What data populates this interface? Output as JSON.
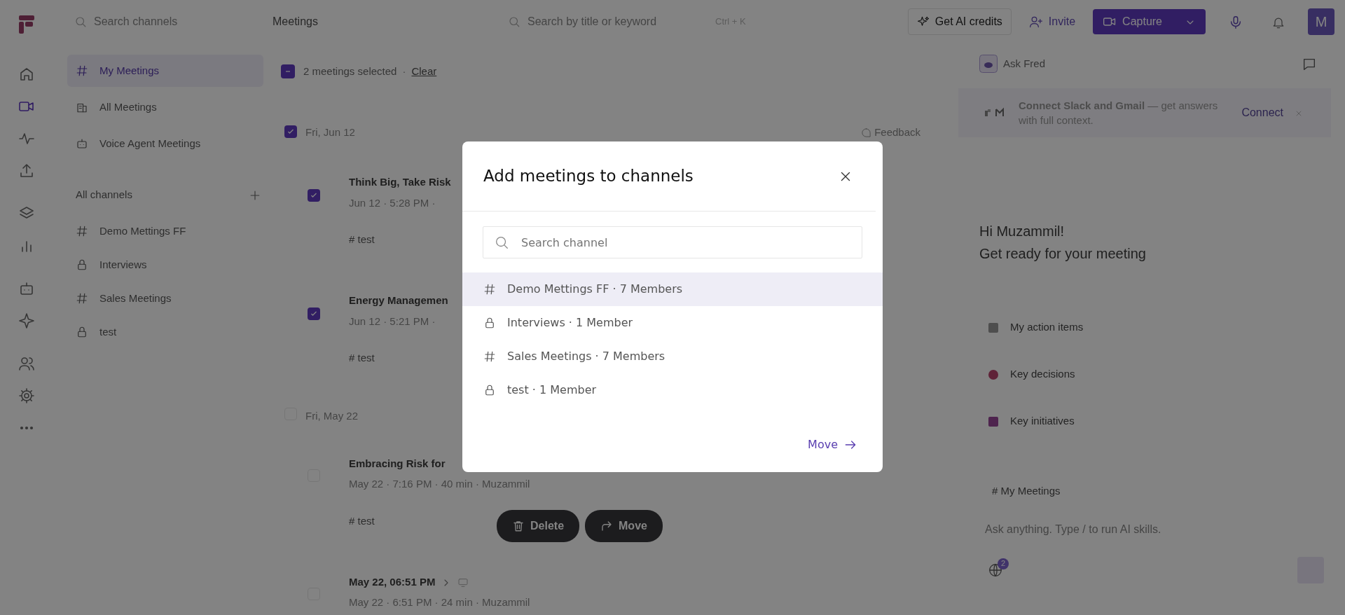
{
  "header": {
    "search_channels": {
      "placeholder": "Search channels"
    },
    "page_title": "Meetings",
    "search": {
      "placeholder": "Search by title or keyword"
    },
    "shortcut": "Ctrl + K",
    "ai_credits": "Get AI credits",
    "invite": "Invite",
    "capture": "Capture",
    "avatar": "M"
  },
  "rail": [
    {
      "selected": false
    },
    {
      "selected": true
    },
    {
      "selected": false
    },
    {
      "selected": false
    },
    {
      "selected": false
    },
    {
      "selected": false
    },
    {
      "selected": false
    },
    {
      "selected": false
    },
    {
      "selected": false
    },
    {
      "selected": false
    },
    {
      "selected": false
    }
  ],
  "sidebar": {
    "nav": [
      {
        "label": "My Meetings",
        "selected": true
      },
      {
        "label": "All Meetings",
        "selected": false
      },
      {
        "label": "Voice Agent Meetings",
        "selected": false
      }
    ],
    "channels_heading": "All channels",
    "channels": [
      {
        "label": "Demo Mettings FF",
        "kind": "public"
      },
      {
        "label": "Interviews",
        "kind": "private"
      },
      {
        "label": "Sales Meetings",
        "kind": "public"
      },
      {
        "label": "test",
        "kind": "private"
      }
    ]
  },
  "selection": {
    "checked": true,
    "count": "2 meetings selected",
    "separator": "·",
    "clear": "Clear"
  },
  "feedback": "Feedback",
  "groups": [
    {
      "date": "Fri, Jun 12",
      "checked": true,
      "meetings": [
        {
          "kind": "titled",
          "title": "Think Big, Take Risk",
          "meta": "Jun 12 · 5:28 PM ·",
          "tag": "# test",
          "checked": true
        },
        {
          "kind": "titled",
          "title": "Energy Managemen",
          "meta": "Jun 12 · 5:21 PM ·",
          "tag": "# test",
          "checked": true
        }
      ]
    },
    {
      "date": "Fri, May 22",
      "checked": false,
      "meetings": [
        {
          "kind": "titled",
          "title": "Embracing Risk for",
          "meta": "May 22 · 7:16 PM · 40 min · Muzammil",
          "tag": "# test",
          "checked": false
        },
        {
          "kind": "timestamp",
          "title": "May 22, 06:51 PM",
          "meta": "May 22 · 6:51 PM · 24 min · Muzammil",
          "checked": false
        }
      ]
    }
  ],
  "floating_actions": [
    "Delete",
    "Move"
  ],
  "assistant": {
    "title": "Ask Fred",
    "banner": {
      "text": "**Connect Slack and Gmail** — get answers with full context.",
      "action": "Connect"
    },
    "greeting": [
      "Hi Muzammil!",
      "Get ready for your meeting"
    ],
    "suggestions": [
      "My action items",
      "Key decisions",
      "Key initiatives"
    ],
    "context": "# My Meetings",
    "input": {
      "placeholder": "Ask anything. Type / to run AI skills."
    },
    "globe_badge": "2"
  },
  "modal": {
    "title": "Add meetings to channels",
    "search": {
      "placeholder": "Search channel"
    },
    "channels": [
      {
        "label": "Demo Mettings FF · 7 Members",
        "kind": "public",
        "selected": true
      },
      {
        "label": "Interviews · 1 Member",
        "kind": "private",
        "selected": false
      },
      {
        "label": "Sales Meetings · 7 Members",
        "kind": "public",
        "selected": false
      },
      {
        "label": "test · 1 Member",
        "kind": "private",
        "selected": false
      }
    ],
    "action": "Move"
  }
}
